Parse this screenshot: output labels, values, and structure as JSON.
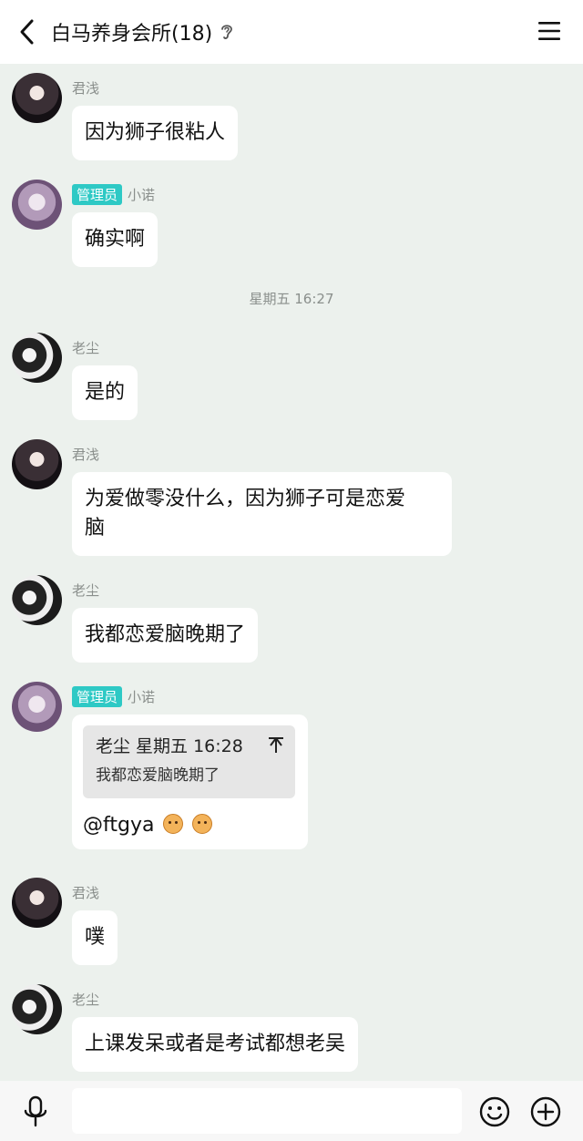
{
  "header": {
    "title": "白马养身会所(18)",
    "back_icon": "chevron-left-icon",
    "ear_icon": "ear-icon",
    "menu_icon": "hamburger-menu-icon"
  },
  "messages": [
    {
      "sender": "君浅",
      "text": "因为狮子很粘人"
    },
    {
      "role": "管理员",
      "sender": "小诺",
      "text": "确实啊"
    },
    {
      "timestamp": "星期五 16:27"
    },
    {
      "sender": "老尘",
      "text": "是的"
    },
    {
      "sender": "君浅",
      "text_line1": "为爱做零没什么，因为狮子可是恋爱",
      "text_line2": "脑"
    },
    {
      "sender": "老尘",
      "text": "我都恋爱脑晚期了"
    },
    {
      "role": "管理员",
      "sender": "小诺",
      "quote_header": "老尘 星期五 16:28",
      "quote_text": "我都恋爱脑晚期了",
      "collapse_icon": "collapse-up-icon",
      "text": "@ftgya"
    },
    {
      "sender": "君浅",
      "text": "噗"
    },
    {
      "sender": "老尘",
      "text": "上课发呆或者是考试都想老吴"
    }
  ],
  "input_bar": {
    "placeholder": "",
    "value": "",
    "mic_icon": "microphone-icon",
    "emoji_icon": "smiley-icon",
    "plus_icon": "plus-circle-icon"
  },
  "colors": {
    "background": "#ecf1ed",
    "bubble": "#ffffff",
    "admin_badge": "#2ec9c5",
    "sender_name": "#8a8f8c"
  }
}
